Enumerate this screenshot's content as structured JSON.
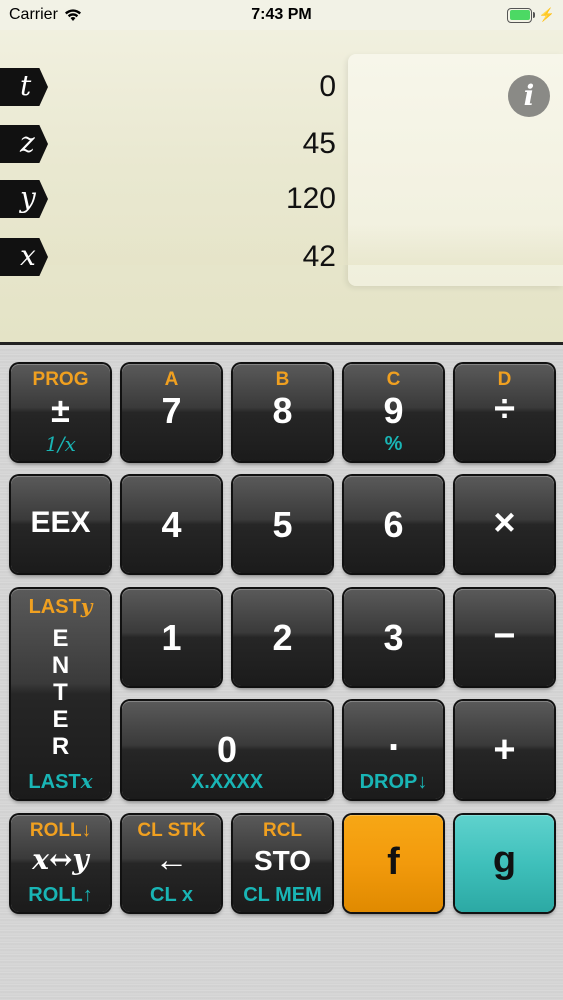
{
  "status": {
    "carrier": "Carrier",
    "time": "7:43 PM",
    "wifi_icon": "wifi-icon",
    "battery_icon": "battery-icon"
  },
  "display": {
    "registers": [
      {
        "name": "t",
        "value": "0"
      },
      {
        "name": "z",
        "value": "45"
      },
      {
        "name": "y",
        "value": "120"
      },
      {
        "name": "x",
        "value": "42"
      }
    ],
    "info_label": "i"
  },
  "keys": {
    "r1": [
      {
        "top": "PROG",
        "main": "±",
        "bot": "1/x"
      },
      {
        "top": "A",
        "main": "7",
        "bot": ""
      },
      {
        "top": "B",
        "main": "8",
        "bot": ""
      },
      {
        "top": "C",
        "main": "9",
        "bot": "%"
      },
      {
        "top": "D",
        "main": "÷",
        "bot": ""
      }
    ],
    "r2": [
      {
        "main": "EEX"
      },
      {
        "main": "4"
      },
      {
        "main": "5"
      },
      {
        "main": "6"
      },
      {
        "main": "×"
      }
    ],
    "r3": [
      {
        "main": "1"
      },
      {
        "main": "2"
      },
      {
        "main": "3"
      },
      {
        "main": "−"
      }
    ],
    "enter": {
      "top": "LAST",
      "top_var": "y",
      "letters": [
        "E",
        "N",
        "T",
        "E",
        "R"
      ],
      "bot": "LAST",
      "bot_var": "x"
    },
    "zero": {
      "main": "0",
      "bot": "X.XXXX"
    },
    "dot": {
      "main": ".",
      "bot": "DROP↓"
    },
    "plus": {
      "main": "+"
    },
    "r5": [
      {
        "top": "ROLL↓",
        "main": "x↔y",
        "bot": "ROLL↑"
      },
      {
        "top": "CL STK",
        "main": "←",
        "bot": "CL x"
      },
      {
        "top": "RCL",
        "main": "STO",
        "bot": "CL MEM"
      },
      {
        "main": "f"
      },
      {
        "main": "g"
      }
    ]
  },
  "colors": {
    "orange_label": "#f0a020",
    "teal_label": "#19b5b5",
    "f_key": "#f29a0c",
    "g_key": "#3fc0bb"
  }
}
